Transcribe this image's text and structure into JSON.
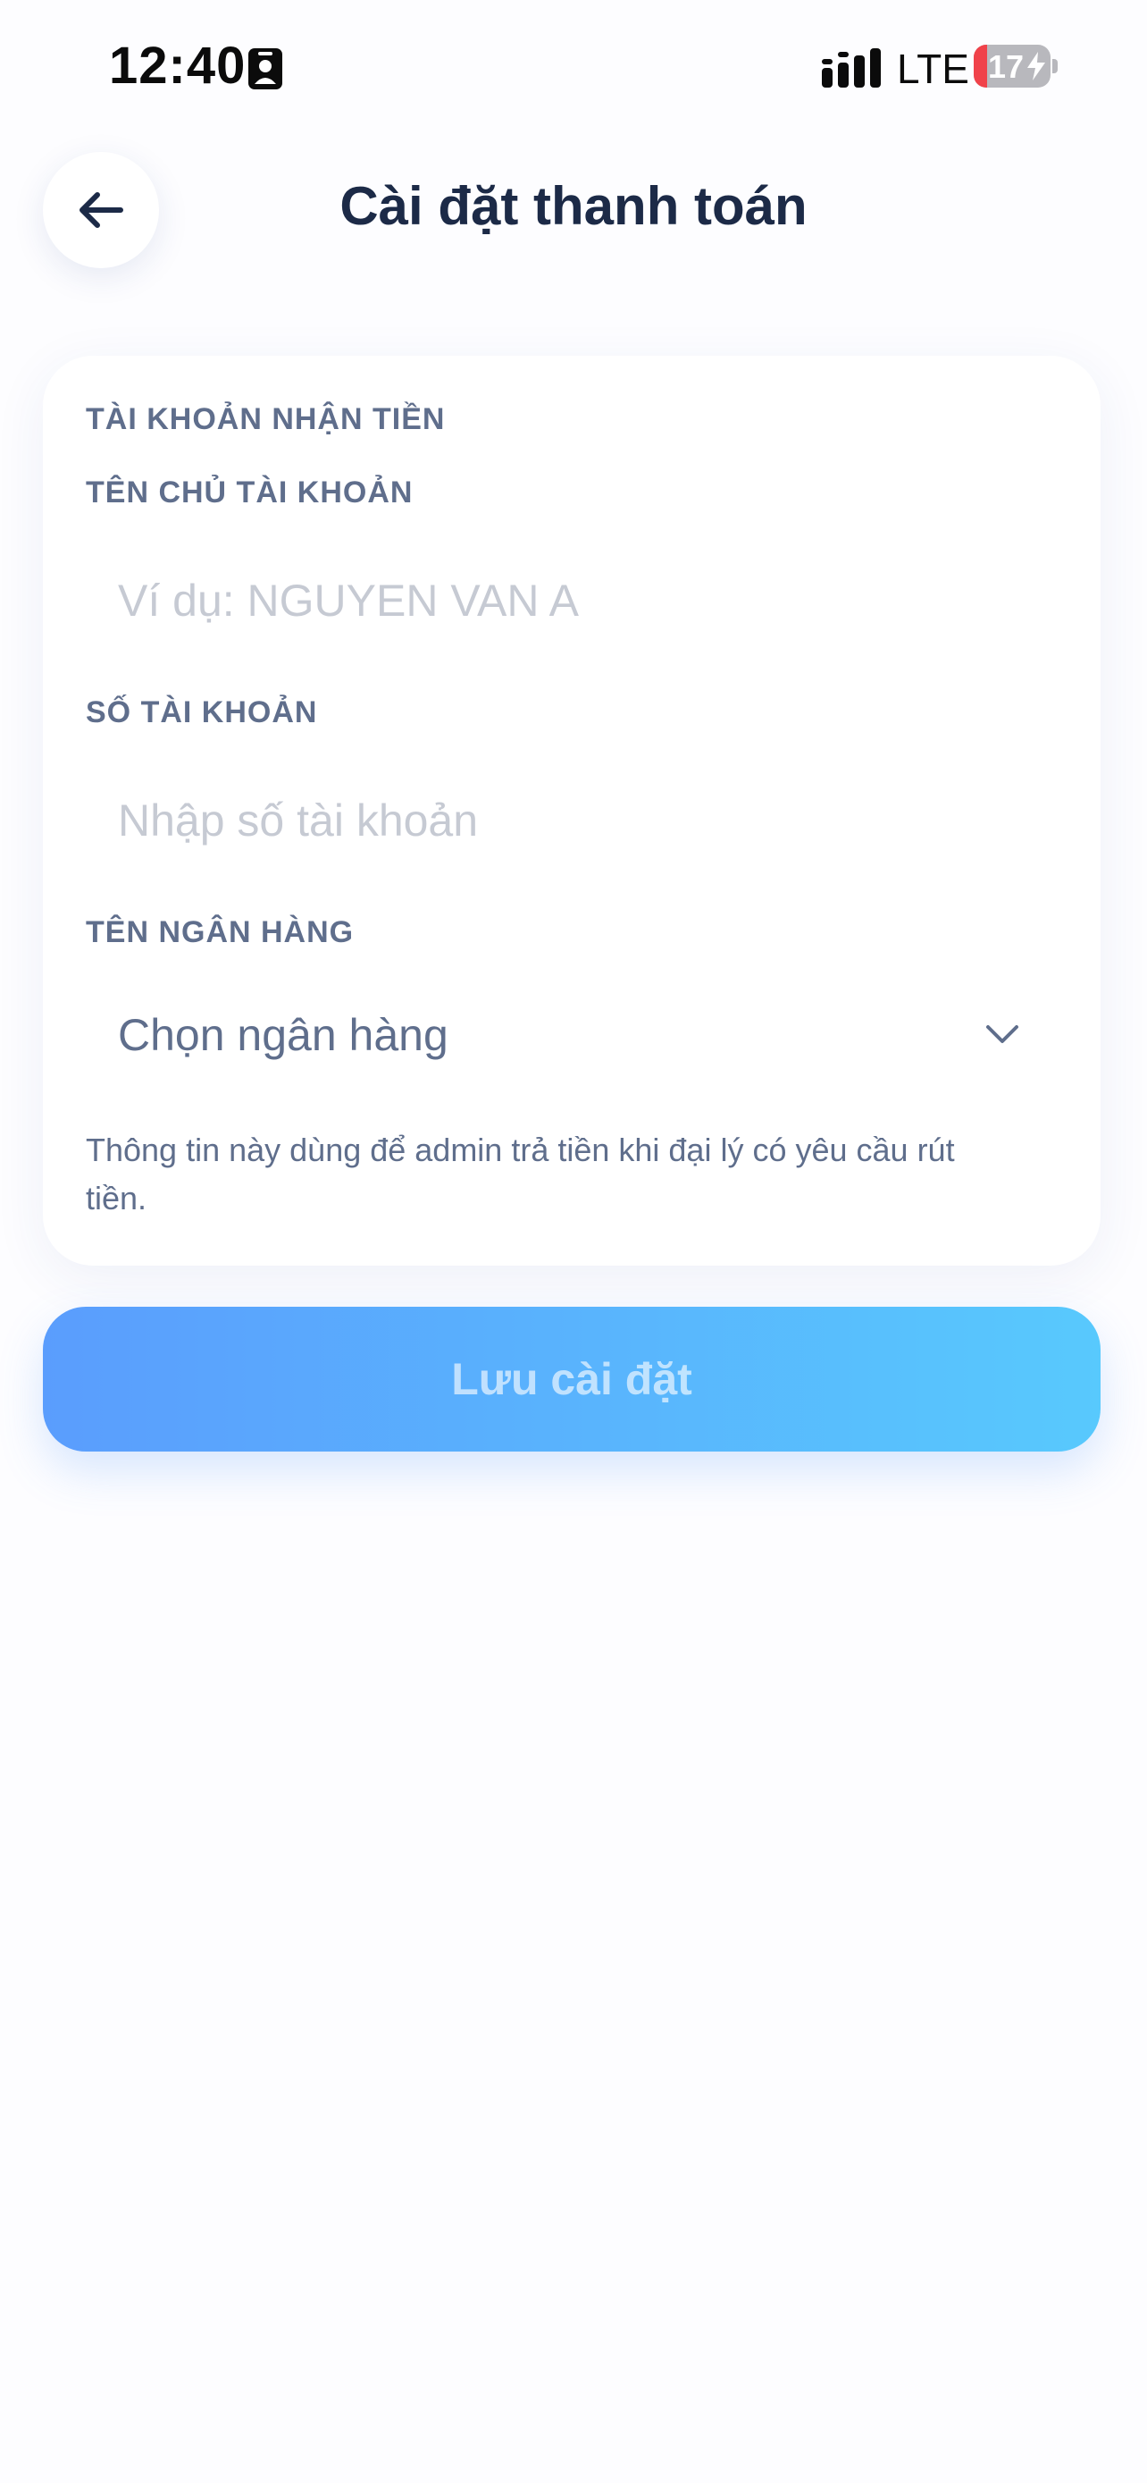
{
  "status_bar": {
    "time": "12:40",
    "network": "LTE",
    "battery_level": "17",
    "battery_fraction": 0.17,
    "icons": [
      "id-card-icon",
      "signal-icon",
      "battery-charging-icon"
    ]
  },
  "header": {
    "back_icon": "arrow-left-icon",
    "title": "Cài đặt thanh toán"
  },
  "form": {
    "section_title": "TÀI KHOẢN NHẬN TIỀN",
    "account_name": {
      "label": "TÊN CHỦ TÀI KHOẢN",
      "value": "",
      "placeholder": "Ví dụ: NGUYEN VAN A"
    },
    "account_number": {
      "label": "SỐ TÀI KHOẢN",
      "value": "",
      "placeholder": "Nhập số tài khoản"
    },
    "bank": {
      "label": "TÊN NGÂN HÀNG",
      "selected": "Chọn ngân hàng",
      "icon": "chevron-down-icon"
    },
    "helper_text": "Thông tin này dùng để admin trả tiền khi đại lý có yêu cầu rút tiền."
  },
  "actions": {
    "save_label": "Lưu cài đặt",
    "save_enabled": false
  },
  "colors": {
    "title": "#1c2a47",
    "label": "#5f6e8c",
    "placeholder": "#c6cad3",
    "button_gradient_start": "#5a9dfd",
    "button_gradient_end": "#58c9fd",
    "battery_low": "#f0424a"
  }
}
